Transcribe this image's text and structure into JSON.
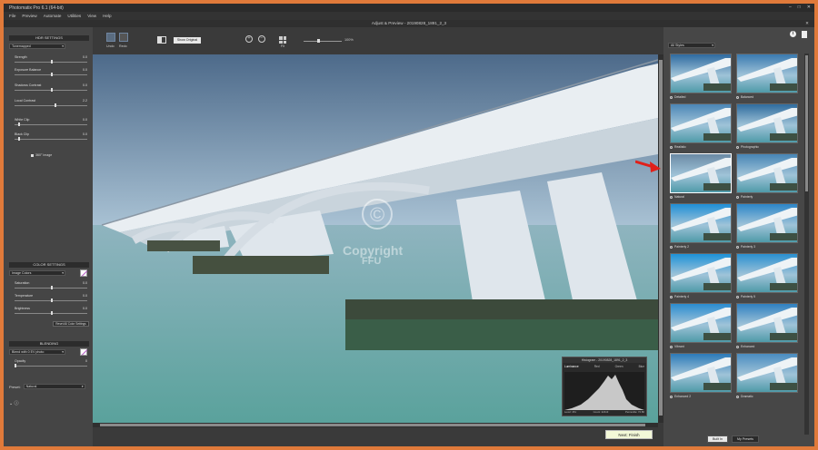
{
  "app_title": "Photomatix Pro 6.1 (64-bit)",
  "window_controls": [
    "–",
    "□",
    "✕"
  ],
  "menu": [
    "File",
    "Preview",
    "Automate",
    "Utilities",
    "View",
    "Help"
  ],
  "doc_title": "Adjust & Preview - 20190828_1891_2_3",
  "doc_close": "✕",
  "left": {
    "hdr_settings": "HDR SETTINGS",
    "method": "Tonemapped",
    "sliders": [
      {
        "label": "Strength",
        "value": "0.0",
        "pos": 0.5
      },
      {
        "label": "Exposure Balance",
        "value": "0.0",
        "pos": 0.5
      },
      {
        "label": "Shadows Contrast",
        "value": "0.0",
        "pos": 0.5
      },
      {
        "label": "Local Contrast",
        "value": "2.2",
        "pos": 0.55
      },
      {
        "label": "White Clip",
        "value": "0.0",
        "pos": 0.05
      },
      {
        "label": "Black Clip",
        "value": "0.0",
        "pos": 0.05
      }
    ],
    "checkbox_360": "360° image",
    "color_settings": "COLOR SETTINGS",
    "color_mode": "Image Colors",
    "color_sliders": [
      {
        "label": "Saturation",
        "value": "0.0",
        "pos": 0.5
      },
      {
        "label": "Temperature",
        "value": "0.0",
        "pos": 0.5
      },
      {
        "label": "Brightness",
        "value": "0.0",
        "pos": 0.5
      }
    ],
    "reset_color": "Reset All Color Settings",
    "blending": "BLENDING",
    "blend_mode": "Blend with 0 EV photo",
    "opacity_label": "Opacity",
    "opacity_value": "0",
    "preset_label": "Preset:",
    "preset_value": "Natural",
    "bottom_icons": "⌄ ⓘ"
  },
  "toolbar": {
    "undo": "Undo",
    "redo": "Redo",
    "show_original": "Show Original",
    "zoom_in": "+",
    "zoom_out": "−",
    "fit": "Fit",
    "zoom_value": "100%"
  },
  "histogram": {
    "title": "Histogram - 20190828_1891_2_3",
    "tabs": [
      "Luminance",
      "Red",
      "Green",
      "Blue"
    ],
    "footer": [
      "Level: 151",
      "Count: 22413",
      "Percentile: 72.80"
    ]
  },
  "watermark": {
    "symbol": "©",
    "line1": "Copyright",
    "line2": "FFU"
  },
  "next_button": "Next: Finish",
  "right": {
    "styles_filter": "All Styles",
    "thumbnails": [
      {
        "label": "Detailed"
      },
      {
        "label": "Balanced"
      },
      {
        "label": "Realistic"
      },
      {
        "label": "Photographic"
      },
      {
        "label": "Natural",
        "selected": true
      },
      {
        "label": "Painterly"
      },
      {
        "label": "Painterly 2"
      },
      {
        "label": "Painterly 3"
      },
      {
        "label": "Painterly 4"
      },
      {
        "label": "Painterly 5"
      },
      {
        "label": "Vibrant"
      },
      {
        "label": "Enhanced"
      },
      {
        "label": "Enhanced 2"
      },
      {
        "label": "Dramatic"
      }
    ],
    "btn_built_in": "Built In",
    "btn_my_presets": "My Presets"
  },
  "colors": {
    "accent_arrow": "#e0201a",
    "sky": "#7fa1bf",
    "water": "#6fa5a8"
  }
}
